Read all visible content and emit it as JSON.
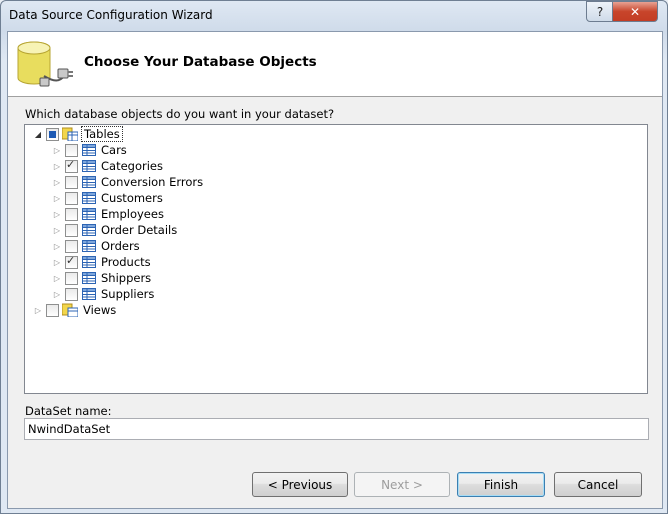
{
  "window": {
    "title": "Data Source Configuration Wizard",
    "help_glyph": "?",
    "close_glyph": "✕"
  },
  "header": {
    "title": "Choose Your Database Objects",
    "icon": "database-plug-icon"
  },
  "question": "Which database objects do you want in your dataset?",
  "tree": {
    "tables_label": "Tables",
    "views_label": "Views",
    "tables": [
      {
        "label": "Cars",
        "checked": false
      },
      {
        "label": "Categories",
        "checked": true
      },
      {
        "label": "Conversion Errors",
        "checked": false
      },
      {
        "label": "Customers",
        "checked": false
      },
      {
        "label": "Employees",
        "checked": false
      },
      {
        "label": "Order Details",
        "checked": false
      },
      {
        "label": "Orders",
        "checked": false
      },
      {
        "label": "Products",
        "checked": true
      },
      {
        "label": "Shippers",
        "checked": false
      },
      {
        "label": "Suppliers",
        "checked": false
      }
    ]
  },
  "dataset": {
    "label": "DataSet name:",
    "value": "NwindDataSet"
  },
  "buttons": {
    "previous": "< Previous",
    "next": "Next >",
    "finish": "Finish",
    "cancel": "Cancel"
  }
}
